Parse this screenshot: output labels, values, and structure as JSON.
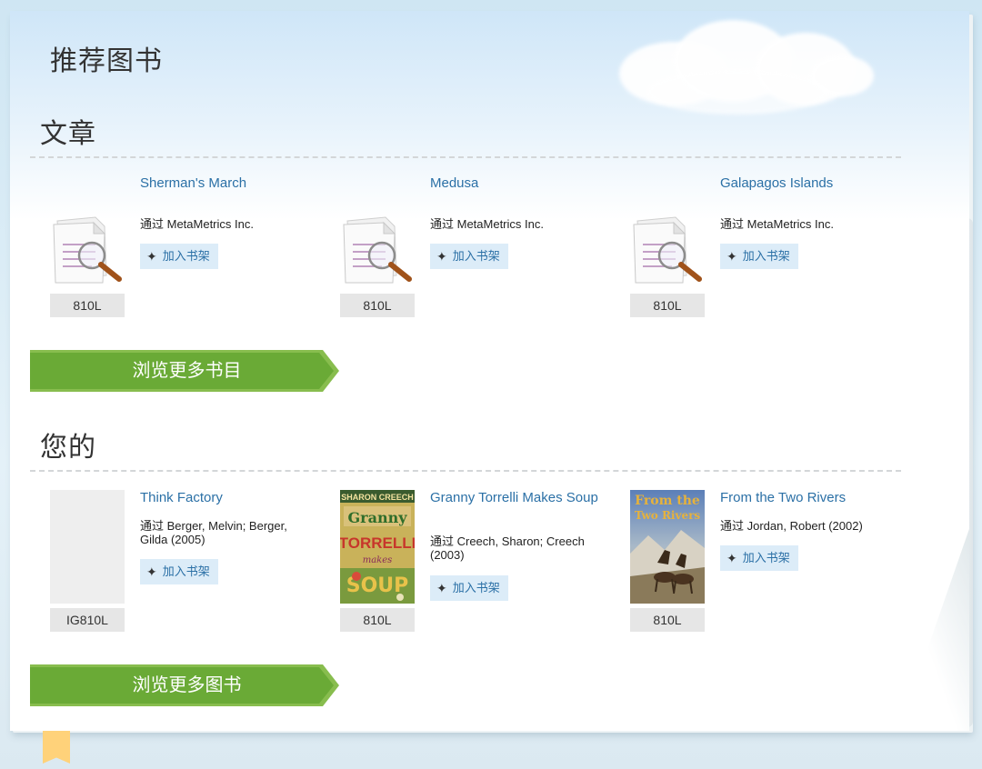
{
  "page": {
    "title": "推荐图书"
  },
  "sections": [
    {
      "title": "文章",
      "more_label": "浏览更多书目",
      "items": [
        {
          "title": "Sherman's March",
          "author": "通过 MetaMetrics Inc.",
          "level": "810L",
          "add_label": "加入书架",
          "thumb": "document-search-icon"
        },
        {
          "title": "Medusa",
          "author": "通过 MetaMetrics Inc.",
          "level": "810L",
          "add_label": "加入书架",
          "thumb": "document-search-icon"
        },
        {
          "title": "Galapagos Islands",
          "author": "通过 MetaMetrics Inc.",
          "level": "810L",
          "add_label": "加入书架",
          "thumb": "document-search-icon"
        }
      ]
    },
    {
      "title": "您的",
      "more_label": "浏览更多图书",
      "items": [
        {
          "title": "Think Factory",
          "author": "通过 Berger, Melvin; Berger, Gilda (2005)",
          "level": "IG810L",
          "add_label": "加入书架",
          "thumb": "blank"
        },
        {
          "title": "Granny Torrelli Makes Soup",
          "author": "通过 Creech, Sharon; Creech (2003)",
          "level": "810L",
          "add_label": "加入书架",
          "thumb": "cover",
          "cover_text": [
            "SHARON CREECH",
            "Granny",
            "TORRELLI",
            "makes",
            "SOUP"
          ]
        },
        {
          "title": "From the Two Rivers",
          "author": "通过 Jordan, Robert (2002)",
          "level": "810L",
          "add_label": "加入书架",
          "thumb": "cover",
          "cover_text": [
            "From the",
            "Two Rivers"
          ]
        }
      ]
    }
  ],
  "colors": {
    "accent_green": "#6aaa36",
    "link_blue": "#2b70a6",
    "button_bg": "#dcecf8"
  }
}
